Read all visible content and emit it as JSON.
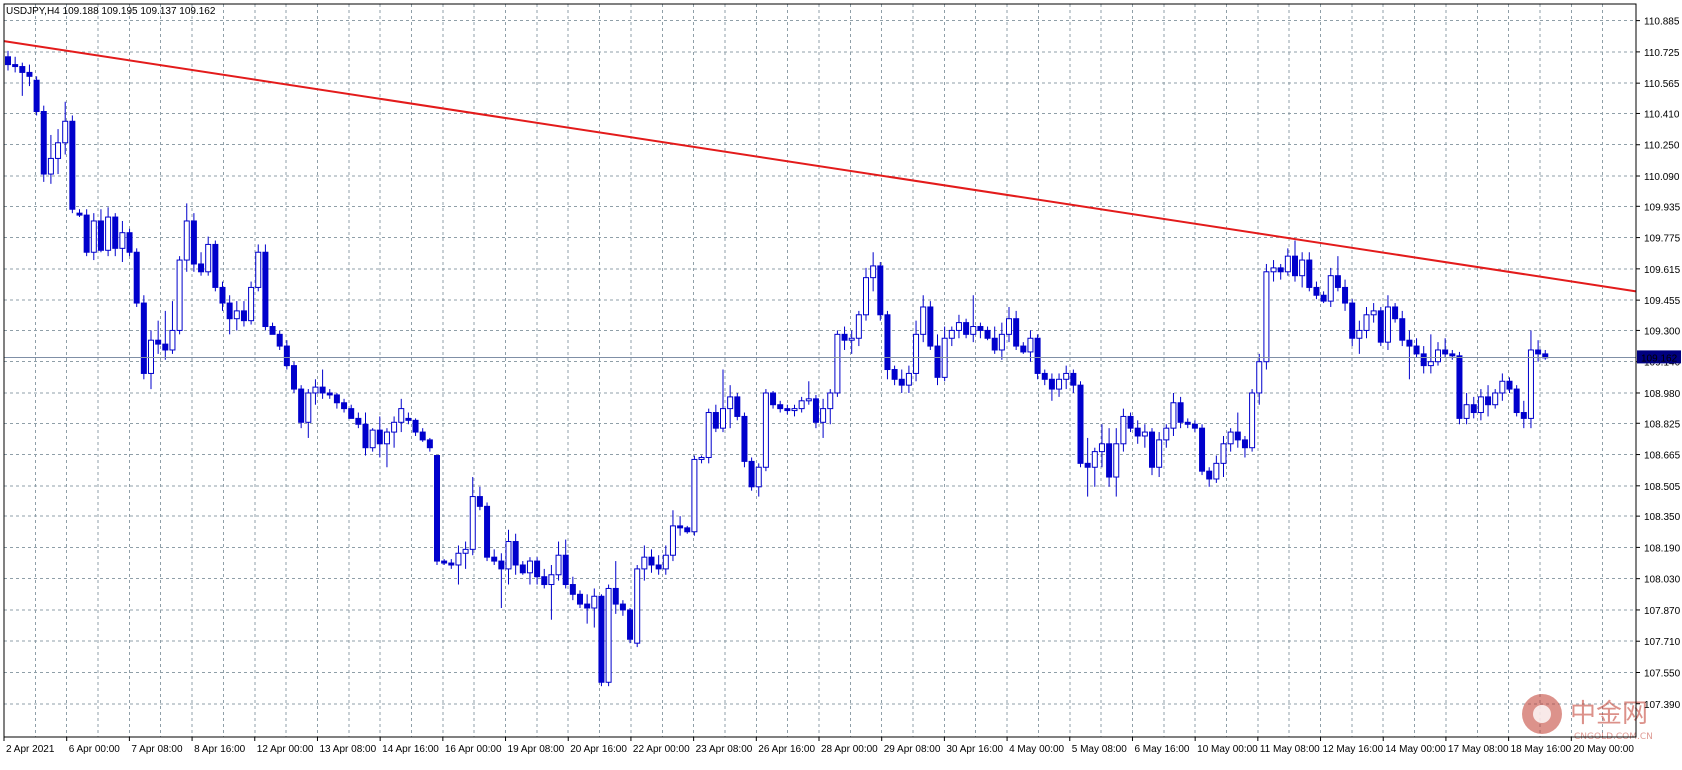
{
  "symbol_header": "USDJPY,H4  109.188 109.195 109.137 109.162",
  "current_price_label": "109.162",
  "watermark": {
    "brand": "中金网",
    "sub": "CNGOLD.COM.CN",
    "color": "#c0392b"
  },
  "colors": {
    "background": "#ffffff",
    "candle_bear": "#0000cc",
    "candle_bull_border": "#0000cc",
    "grid": "#8f9fa8",
    "trendline": "#e31b1b",
    "price_line": "#7f8fa6",
    "price_label_bg": "#000080"
  },
  "chart_data": {
    "type": "candlestick",
    "title": "USDJPY,H4",
    "ylim": [
      107.22,
      110.97
    ],
    "y_ticks": [
      "110.885",
      "110.725",
      "110.565",
      "110.410",
      "110.250",
      "110.090",
      "109.935",
      "109.775",
      "109.615",
      "109.455",
      "109.300",
      "109.140",
      "108.980",
      "108.825",
      "108.665",
      "108.505",
      "108.350",
      "108.190",
      "108.030",
      "107.870",
      "107.710",
      "107.550",
      "107.390"
    ],
    "x_labels": [
      "2 Apr 2021",
      "6 Apr 00:00",
      "7 Apr 08:00",
      "8 Apr 16:00",
      "12 Apr 00:00",
      "13 Apr 08:00",
      "14 Apr 16:00",
      "16 Apr 00:00",
      "19 Apr 08:00",
      "20 Apr 16:00",
      "22 Apr 00:00",
      "23 Apr 08:00",
      "26 Apr 16:00",
      "28 Apr 00:00",
      "29 Apr 08:00",
      "30 Apr 16:00",
      "4 May 00:00",
      "5 May 08:00",
      "6 May 16:00",
      "10 May 00:00",
      "11 May 08:00",
      "12 May 16:00",
      "14 May 00:00",
      "17 May 08:00",
      "18 May 16:00",
      "20 May 00:00"
    ],
    "grid": true,
    "current_price": 109.162,
    "trendline": {
      "from_index": 0,
      "from_price": 110.78,
      "to_index": 220,
      "to_price": 109.5,
      "color": "#e31b1b"
    },
    "candles": [
      [
        110.7,
        110.73,
        110.63,
        110.66
      ],
      [
        110.66,
        110.7,
        110.62,
        110.65
      ],
      [
        110.65,
        110.67,
        110.5,
        110.62
      ],
      [
        110.62,
        110.66,
        110.55,
        110.6
      ],
      [
        110.58,
        110.6,
        110.4,
        110.42
      ],
      [
        110.42,
        110.45,
        110.06,
        110.1
      ],
      [
        110.1,
        110.3,
        110.05,
        110.18
      ],
      [
        110.18,
        110.33,
        110.1,
        110.26
      ],
      [
        110.26,
        110.47,
        110.2,
        110.37
      ],
      [
        110.37,
        110.4,
        109.9,
        109.92
      ],
      [
        109.9,
        109.92,
        109.88,
        109.89
      ],
      [
        109.89,
        109.92,
        109.68,
        109.7
      ],
      [
        109.7,
        109.9,
        109.66,
        109.86
      ],
      [
        109.86,
        109.92,
        109.7,
        109.71
      ],
      [
        109.71,
        109.93,
        109.68,
        109.88
      ],
      [
        109.88,
        109.9,
        109.68,
        109.72
      ],
      [
        109.72,
        109.86,
        109.65,
        109.8
      ],
      [
        109.8,
        109.82,
        109.68,
        109.7
      ],
      [
        109.7,
        109.72,
        109.42,
        109.44
      ],
      [
        109.44,
        109.48,
        109.05,
        109.08
      ],
      [
        109.08,
        109.3,
        109.0,
        109.25
      ],
      [
        109.25,
        109.35,
        109.18,
        109.23
      ],
      [
        109.23,
        109.4,
        109.15,
        109.2
      ],
      [
        109.2,
        109.45,
        109.18,
        109.3
      ],
      [
        109.3,
        109.68,
        109.28,
        109.66
      ],
      [
        109.66,
        109.95,
        109.6,
        109.86
      ],
      [
        109.86,
        109.9,
        109.6,
        109.64
      ],
      [
        109.64,
        109.7,
        109.58,
        109.6
      ],
      [
        109.6,
        109.78,
        109.58,
        109.74
      ],
      [
        109.74,
        109.76,
        109.5,
        109.52
      ],
      [
        109.52,
        109.55,
        109.4,
        109.44
      ],
      [
        109.44,
        109.48,
        109.28,
        109.36
      ],
      [
        109.36,
        109.45,
        109.3,
        109.4
      ],
      [
        109.4,
        109.45,
        109.32,
        109.35
      ],
      [
        109.35,
        109.55,
        109.33,
        109.52
      ],
      [
        109.52,
        109.74,
        109.5,
        109.7
      ],
      [
        109.7,
        109.74,
        109.3,
        109.32
      ],
      [
        109.32,
        109.34,
        109.28,
        109.28
      ],
      [
        109.28,
        109.3,
        109.2,
        109.22
      ],
      [
        109.22,
        109.25,
        109.1,
        109.12
      ],
      [
        109.12,
        109.14,
        108.98,
        109.0
      ],
      [
        109.0,
        109.02,
        108.8,
        108.83
      ],
      [
        108.83,
        109.0,
        108.75,
        108.98
      ],
      [
        108.98,
        109.05,
        108.92,
        109.01
      ],
      [
        109.01,
        109.1,
        108.95,
        108.98
      ],
      [
        108.98,
        109.0,
        108.95,
        108.97
      ],
      [
        108.97,
        108.98,
        108.9,
        108.93
      ],
      [
        108.93,
        108.95,
        108.88,
        108.9
      ],
      [
        108.9,
        108.92,
        108.85,
        108.85
      ],
      [
        108.85,
        108.88,
        108.8,
        108.82
      ],
      [
        108.82,
        108.88,
        108.66,
        108.7
      ],
      [
        108.7,
        108.8,
        108.68,
        108.79
      ],
      [
        108.79,
        108.86,
        108.65,
        108.72
      ],
      [
        108.72,
        108.8,
        108.6,
        108.78
      ],
      [
        108.78,
        108.86,
        108.7,
        108.83
      ],
      [
        108.83,
        108.95,
        108.78,
        108.9
      ],
      [
        108.85,
        108.88,
        108.82,
        108.84
      ],
      [
        108.84,
        108.85,
        108.76,
        108.78
      ],
      [
        108.78,
        108.8,
        108.73,
        108.74
      ],
      [
        108.74,
        108.75,
        108.68,
        108.7
      ],
      [
        108.66,
        108.66,
        108.1,
        108.12
      ],
      [
        108.12,
        108.13,
        108.1,
        108.11
      ],
      [
        108.11,
        108.13,
        108.08,
        108.1
      ],
      [
        108.1,
        108.2,
        108.0,
        108.16
      ],
      [
        108.16,
        108.22,
        108.08,
        108.18
      ],
      [
        108.18,
        108.55,
        108.15,
        108.45
      ],
      [
        108.45,
        108.5,
        108.38,
        108.4
      ],
      [
        108.4,
        108.42,
        108.12,
        108.14
      ],
      [
        108.14,
        108.18,
        108.1,
        108.12
      ],
      [
        108.12,
        108.16,
        107.88,
        108.08
      ],
      [
        108.08,
        108.28,
        108.0,
        108.22
      ],
      [
        108.22,
        108.26,
        108.05,
        108.1
      ],
      [
        108.1,
        108.12,
        108.05,
        108.06
      ],
      [
        108.06,
        108.14,
        108.0,
        108.12
      ],
      [
        108.12,
        108.14,
        108.0,
        108.04
      ],
      [
        108.04,
        108.08,
        107.98,
        108.0
      ],
      [
        108.0,
        108.1,
        107.82,
        108.05
      ],
      [
        108.05,
        108.22,
        108.02,
        108.15
      ],
      [
        108.15,
        108.23,
        107.98,
        108.0
      ],
      [
        108.0,
        108.04,
        107.92,
        107.95
      ],
      [
        107.95,
        107.97,
        107.88,
        107.9
      ],
      [
        107.9,
        107.95,
        107.8,
        107.88
      ],
      [
        107.88,
        107.98,
        107.78,
        107.94
      ],
      [
        107.94,
        107.95,
        107.48,
        107.5
      ],
      [
        107.5,
        108.0,
        107.48,
        107.98
      ],
      [
        107.98,
        108.12,
        107.85,
        107.9
      ],
      [
        107.9,
        107.92,
        107.84,
        107.87
      ],
      [
        107.87,
        107.88,
        107.7,
        107.72
      ],
      [
        107.7,
        108.1,
        107.68,
        108.08
      ],
      [
        108.08,
        108.2,
        108.02,
        108.14
      ],
      [
        108.14,
        108.18,
        108.06,
        108.1
      ],
      [
        108.1,
        108.15,
        108.05,
        108.08
      ],
      [
        108.08,
        108.2,
        108.05,
        108.15
      ],
      [
        108.15,
        108.38,
        108.12,
        108.3
      ],
      [
        108.3,
        108.35,
        108.25,
        108.29
      ],
      [
        108.29,
        108.3,
        108.26,
        108.27
      ],
      [
        108.27,
        108.66,
        108.25,
        108.64
      ],
      [
        108.64,
        108.66,
        108.62,
        108.65
      ],
      [
        108.65,
        108.9,
        108.62,
        108.88
      ],
      [
        108.88,
        108.92,
        108.78,
        108.8
      ],
      [
        108.8,
        109.1,
        108.78,
        108.9
      ],
      [
        108.9,
        109.02,
        108.8,
        108.96
      ],
      [
        108.96,
        108.98,
        108.84,
        108.86
      ],
      [
        108.86,
        108.88,
        108.6,
        108.63
      ],
      [
        108.63,
        108.65,
        108.48,
        108.5
      ],
      [
        108.5,
        108.62,
        108.45,
        108.6
      ],
      [
        108.6,
        109.0,
        108.58,
        108.98
      ],
      [
        108.98,
        108.99,
        108.9,
        108.92
      ],
      [
        108.92,
        108.94,
        108.88,
        108.9
      ],
      [
        108.9,
        108.92,
        108.87,
        108.89
      ],
      [
        108.89,
        108.92,
        108.86,
        108.9
      ],
      [
        108.9,
        108.96,
        108.88,
        108.94
      ],
      [
        108.94,
        109.04,
        108.92,
        108.95
      ],
      [
        108.95,
        108.97,
        108.8,
        108.83
      ],
      [
        108.83,
        108.95,
        108.75,
        108.9
      ],
      [
        108.9,
        109.0,
        108.82,
        108.98
      ],
      [
        108.98,
        109.3,
        108.96,
        109.28
      ],
      [
        109.28,
        109.32,
        109.2,
        109.25
      ],
      [
        109.25,
        109.3,
        109.18,
        109.26
      ],
      [
        109.26,
        109.4,
        109.22,
        109.38
      ],
      [
        109.38,
        109.62,
        109.35,
        109.57
      ],
      [
        109.57,
        109.7,
        109.5,
        109.63
      ],
      [
        109.63,
        109.65,
        109.35,
        109.38
      ],
      [
        109.38,
        109.4,
        109.05,
        109.1
      ],
      [
        109.1,
        109.12,
        109.02,
        109.05
      ],
      [
        109.05,
        109.1,
        108.98,
        109.02
      ],
      [
        109.02,
        109.12,
        108.98,
        109.08
      ],
      [
        109.08,
        109.35,
        109.04,
        109.28
      ],
      [
        109.28,
        109.48,
        109.24,
        109.42
      ],
      [
        109.42,
        109.45,
        109.2,
        109.22
      ],
      [
        109.22,
        109.28,
        109.02,
        109.06
      ],
      [
        109.06,
        109.32,
        109.04,
        109.26
      ],
      [
        109.26,
        109.32,
        109.22,
        109.3
      ],
      [
        109.3,
        109.38,
        109.26,
        109.34
      ],
      [
        109.34,
        109.36,
        109.26,
        109.28
      ],
      [
        109.28,
        109.48,
        109.24,
        109.32
      ],
      [
        109.32,
        109.34,
        109.26,
        109.3
      ],
      [
        109.3,
        109.32,
        109.25,
        109.26
      ],
      [
        109.26,
        109.32,
        109.18,
        109.2
      ],
      [
        109.2,
        109.34,
        109.15,
        109.28
      ],
      [
        109.28,
        109.42,
        109.24,
        109.36
      ],
      [
        109.36,
        109.4,
        109.2,
        109.22
      ],
      [
        109.22,
        109.24,
        109.18,
        109.19
      ],
      [
        109.19,
        109.3,
        109.14,
        109.26
      ],
      [
        109.26,
        109.28,
        109.05,
        109.08
      ],
      [
        109.08,
        109.1,
        109.02,
        109.05
      ],
      [
        109.05,
        109.08,
        108.94,
        109.0
      ],
      [
        109.0,
        109.08,
        108.96,
        109.05
      ],
      [
        109.05,
        109.12,
        109.0,
        109.08
      ],
      [
        109.08,
        109.1,
        108.98,
        109.02
      ],
      [
        109.02,
        109.04,
        108.6,
        108.62
      ],
      [
        108.62,
        108.75,
        108.45,
        108.6
      ],
      [
        108.6,
        108.7,
        108.5,
        108.68
      ],
      [
        108.68,
        108.82,
        108.6,
        108.72
      ],
      [
        108.72,
        108.8,
        108.5,
        108.55
      ],
      [
        108.55,
        108.8,
        108.45,
        108.72
      ],
      [
        108.72,
        108.9,
        108.68,
        108.86
      ],
      [
        108.86,
        108.88,
        108.78,
        108.8
      ],
      [
        108.8,
        108.84,
        108.72,
        108.76
      ],
      [
        108.76,
        108.82,
        108.7,
        108.78
      ],
      [
        108.78,
        108.8,
        108.56,
        108.6
      ],
      [
        108.6,
        108.78,
        108.55,
        108.74
      ],
      [
        108.74,
        108.82,
        108.7,
        108.8
      ],
      [
        108.8,
        108.98,
        108.76,
        108.93
      ],
      [
        108.93,
        108.96,
        108.8,
        108.83
      ],
      [
        108.83,
        108.85,
        108.8,
        108.82
      ],
      [
        108.82,
        108.84,
        108.78,
        108.8
      ],
      [
        108.8,
        108.82,
        108.56,
        108.58
      ],
      [
        108.58,
        108.6,
        108.5,
        108.54
      ],
      [
        108.54,
        108.66,
        108.52,
        108.62
      ],
      [
        108.62,
        108.76,
        108.55,
        108.72
      ],
      [
        108.72,
        108.8,
        108.68,
        108.78
      ],
      [
        108.78,
        108.88,
        108.7,
        108.74
      ],
      [
        108.74,
        108.76,
        108.65,
        108.7
      ],
      [
        108.7,
        109.0,
        108.68,
        108.98
      ],
      [
        108.98,
        109.18,
        108.92,
        109.14
      ],
      [
        109.14,
        109.64,
        109.1,
        109.6
      ],
      [
        109.6,
        109.66,
        109.55,
        109.62
      ],
      [
        109.62,
        109.64,
        109.56,
        109.6
      ],
      [
        109.6,
        109.72,
        109.58,
        109.68
      ],
      [
        109.68,
        109.76,
        109.55,
        109.58
      ],
      [
        109.58,
        109.7,
        109.52,
        109.66
      ],
      [
        109.66,
        109.7,
        109.5,
        109.52
      ],
      [
        109.52,
        109.55,
        109.46,
        109.48
      ],
      [
        109.48,
        109.5,
        109.44,
        109.45
      ],
      [
        109.45,
        109.62,
        109.42,
        109.58
      ],
      [
        109.58,
        109.68,
        109.5,
        109.52
      ],
      [
        109.52,
        109.56,
        109.4,
        109.44
      ],
      [
        109.44,
        109.46,
        109.22,
        109.26
      ],
      [
        109.26,
        109.35,
        109.18,
        109.3
      ],
      [
        109.3,
        109.42,
        109.26,
        109.38
      ],
      [
        109.38,
        109.44,
        109.34,
        109.4
      ],
      [
        109.4,
        109.42,
        109.22,
        109.24
      ],
      [
        109.24,
        109.48,
        109.2,
        109.42
      ],
      [
        109.42,
        109.44,
        109.34,
        109.36
      ],
      [
        109.36,
        109.4,
        109.22,
        109.25
      ],
      [
        109.25,
        109.3,
        109.05,
        109.22
      ],
      [
        109.22,
        109.26,
        109.16,
        109.18
      ],
      [
        109.18,
        109.22,
        109.08,
        109.12
      ],
      [
        109.12,
        109.28,
        109.08,
        109.14
      ],
      [
        109.14,
        109.24,
        109.12,
        109.2
      ],
      [
        109.2,
        109.26,
        109.16,
        109.18
      ],
      [
        109.18,
        109.2,
        109.15,
        109.17
      ],
      [
        109.17,
        109.19,
        108.82,
        108.85
      ],
      [
        108.85,
        108.98,
        108.82,
        108.92
      ],
      [
        108.92,
        108.96,
        108.85,
        108.88
      ],
      [
        108.88,
        109.0,
        108.84,
        108.96
      ],
      [
        108.96,
        109.02,
        108.86,
        108.92
      ],
      [
        108.92,
        109.0,
        108.9,
        108.98
      ],
      [
        108.98,
        109.08,
        108.94,
        109.04
      ],
      [
        109.04,
        109.06,
        108.98,
        109.0
      ],
      [
        109.0,
        109.02,
        108.86,
        108.88
      ],
      [
        108.88,
        108.94,
        108.8,
        108.85
      ],
      [
        108.85,
        109.3,
        108.8,
        109.2
      ],
      [
        109.2,
        109.25,
        109.14,
        109.18
      ],
      [
        109.18,
        109.2,
        109.15,
        109.16
      ]
    ]
  }
}
